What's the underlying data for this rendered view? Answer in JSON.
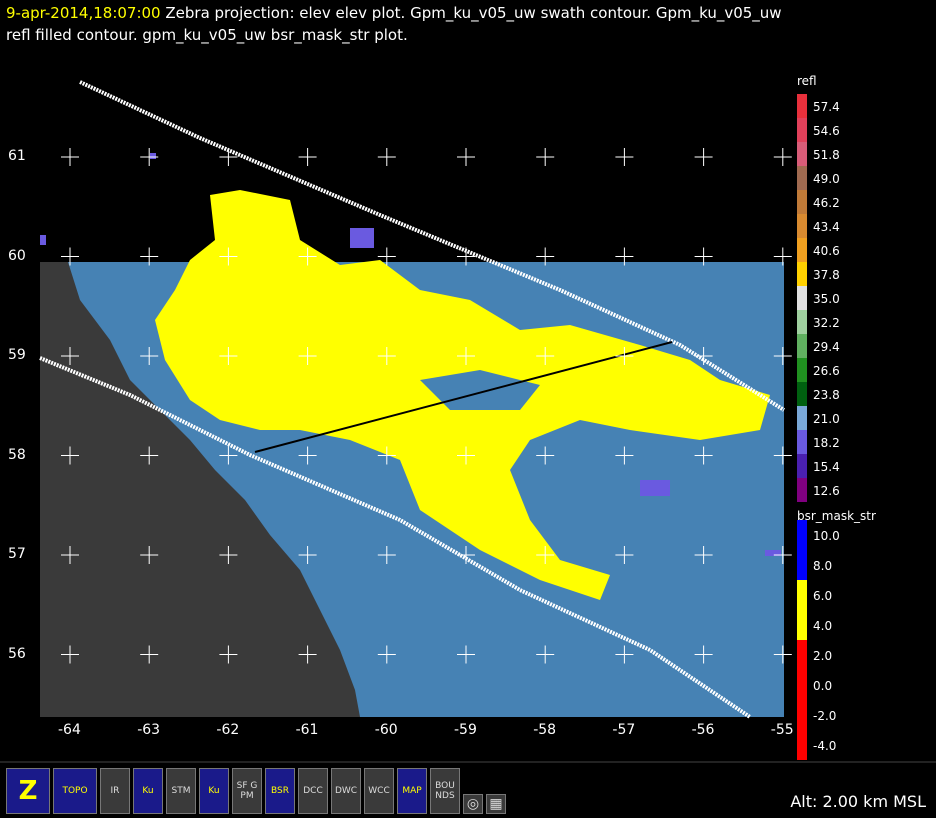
{
  "header": {
    "timestamp": "9-apr-2014,18:07:00",
    "line1_rest": " Zebra projection: elev elev  plot.  Gpm_ku_v05_uw swath contour.  Gpm_ku_v05_uw",
    "line2": "refl filled contour.  gpm_ku_v05_uw bsr_mask_str  plot."
  },
  "map": {
    "lon_ticks": [
      "-64",
      "-63",
      "-62",
      "-61",
      "-60",
      "-59",
      "-58",
      "-57",
      "-56",
      "-55"
    ],
    "lat_ticks": [
      "61",
      "60",
      "59",
      "58",
      "57",
      "56"
    ],
    "colors": {
      "ocean": "#4682b4",
      "land": "#3a3a3a",
      "precip": "#ffff00",
      "swath": "#ffffff",
      "cross_section": "#000000"
    }
  },
  "legend_refl": {
    "title": "refl",
    "items": [
      {
        "label": "57.4",
        "color": "#e8303c"
      },
      {
        "label": "54.6",
        "color": "#e0405a"
      },
      {
        "label": "51.8",
        "color": "#d85c78"
      },
      {
        "label": "49.0",
        "color": "#a06a50"
      },
      {
        "label": "46.2",
        "color": "#c07a38"
      },
      {
        "label": "43.4",
        "color": "#d88a30"
      },
      {
        "label": "40.6",
        "color": "#f0a020"
      },
      {
        "label": "37.8",
        "color": "#ffd000"
      },
      {
        "label": "35.0",
        "color": "#e0e0e0"
      },
      {
        "label": "32.2",
        "color": "#a0d0a0"
      },
      {
        "label": "29.4",
        "color": "#60b060"
      },
      {
        "label": "26.6",
        "color": "#209020"
      },
      {
        "label": "23.8",
        "color": "#006010"
      },
      {
        "label": "21.0",
        "color": "#7aa8d8"
      },
      {
        "label": "18.2",
        "color": "#6a5ae0"
      },
      {
        "label": "15.4",
        "color": "#4a20b0"
      },
      {
        "label": "12.6",
        "color": "#800080"
      }
    ]
  },
  "legend_bsr": {
    "title": "bsr_mask_str",
    "items": [
      {
        "label": "10.0",
        "color": "#0000ff"
      },
      {
        "label": "8.0",
        "color": "#0000ff"
      },
      {
        "label": "6.0",
        "color": "#ffff00"
      },
      {
        "label": "4.0",
        "color": "#ffff00"
      },
      {
        "label": "2.0",
        "color": "#ff0000"
      },
      {
        "label": "0.0",
        "color": "#ff0000"
      },
      {
        "label": "-2.0",
        "color": "#ff0000"
      },
      {
        "label": "-4.0",
        "color": "#ff0000"
      }
    ]
  },
  "toolbar": {
    "buttons": [
      "Z",
      "TOPO",
      "IR",
      "Ku",
      "STM",
      "Ku",
      "SF GPM",
      "BSR",
      "DCC",
      "DWC",
      "WCC",
      "MAP",
      "BOUNDS"
    ]
  },
  "status": {
    "altitude": "Alt: 2.00 km MSL"
  }
}
